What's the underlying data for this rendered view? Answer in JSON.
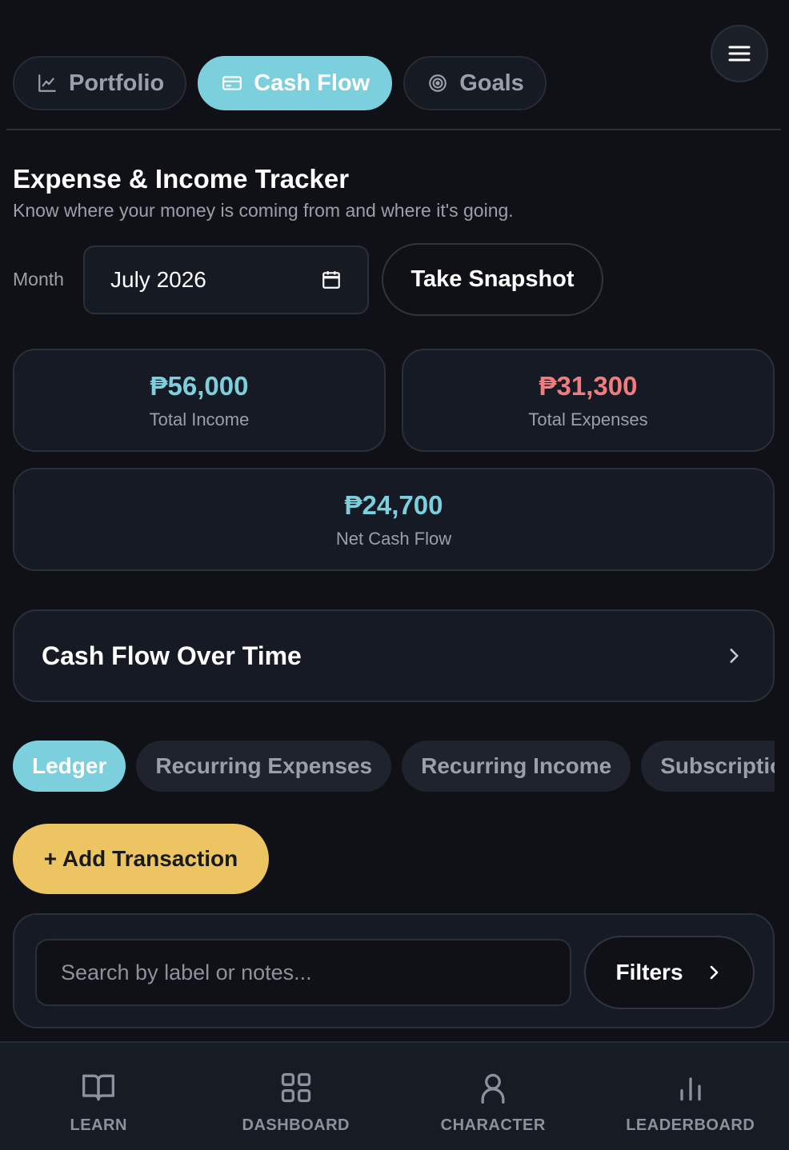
{
  "top_tabs": [
    {
      "label": "Portfolio",
      "icon": "chart-line-icon",
      "active": false
    },
    {
      "label": "Cash Flow",
      "icon": "wallet-icon",
      "active": true
    },
    {
      "label": "Goals",
      "icon": "target-icon",
      "active": false
    }
  ],
  "menu": {
    "icon": "hamburger-menu-icon"
  },
  "header": {
    "title": "Expense & Income Tracker",
    "subtitle": "Know where your money is coming from and where it's going."
  },
  "month": {
    "label": "Month",
    "value": "July  2026",
    "icon": "calendar-icon"
  },
  "snapshot": {
    "label": "Take Snapshot"
  },
  "stats": {
    "income": {
      "value": "₱56,000",
      "label": "Total Income",
      "color": "#7ccfdc"
    },
    "expenses": {
      "value": "₱31,300",
      "label": "Total Expenses",
      "color": "#ef7d7f"
    },
    "net": {
      "value": "₱24,700",
      "label": "Net Cash Flow",
      "color": "#7ccfdc"
    }
  },
  "cashflow_over_time": {
    "label": "Cash Flow Over Time",
    "icon": "chevron-right-icon"
  },
  "sub_tabs": [
    {
      "label": "Ledger",
      "active": true
    },
    {
      "label": "Recurring Expenses",
      "active": false
    },
    {
      "label": "Recurring Income",
      "active": false
    },
    {
      "label": "Subscriptions",
      "active": false
    }
  ],
  "add_transaction": {
    "label": "+ Add Transaction",
    "color": "#ecc462"
  },
  "search": {
    "placeholder": "Search by label or notes...",
    "value": ""
  },
  "filters": {
    "label": "Filters",
    "icon": "chevron-right-icon"
  },
  "bottom_nav": [
    {
      "label": "LEARN",
      "icon": "book-icon"
    },
    {
      "label": "DASHBOARD",
      "icon": "grid-icon"
    },
    {
      "label": "CHARACTER",
      "icon": "person-icon"
    },
    {
      "label": "LEADERBOARD",
      "icon": "bar-chart-icon"
    }
  ],
  "colors": {
    "accent": "#7ccfdc",
    "background": "#0f1116",
    "expense": "#ef7d7f"
  }
}
